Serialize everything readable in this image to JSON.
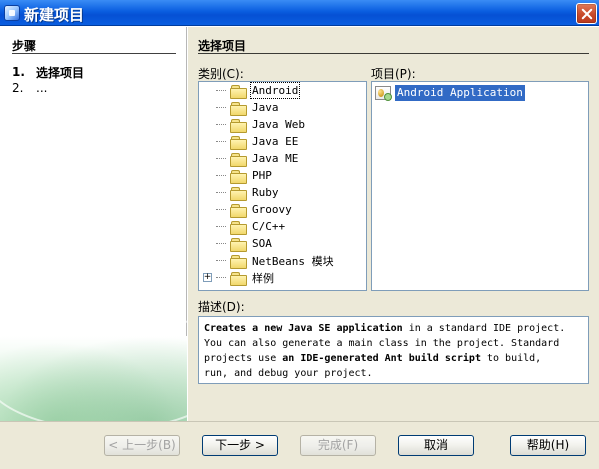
{
  "window": {
    "title": "新建项目"
  },
  "left": {
    "title": "步骤",
    "steps": [
      {
        "num": "1.",
        "label": "选择项目"
      },
      {
        "num": "2.",
        "label": "..."
      }
    ]
  },
  "main": {
    "section_title": "选择项目",
    "categories_label": "类别(C):",
    "projects_label": "项目(P):",
    "categories": [
      "Android",
      "Java",
      "Java Web",
      "Java EE",
      "Java ME",
      "PHP",
      "Ruby",
      "Groovy",
      "C/C++",
      "SOA",
      "NetBeans 模块",
      "样例"
    ],
    "projects": [
      "Android Application"
    ],
    "description_label": "描述(D):",
    "description": {
      "b1": "Creates a new Java SE application",
      "t1": " in a standard IDE project.",
      "t2": "You can also generate a main class in the project. Standard",
      "t3a": "projects use ",
      "b2": "an IDE-generated Ant build script",
      "t3b": " to build,",
      "t4": "run, and debug your project."
    }
  },
  "buttons": {
    "back": "< 上一步(B)",
    "next": "下一步 >",
    "finish": "完成(F)",
    "cancel": "取消",
    "help": "帮助(H)"
  }
}
